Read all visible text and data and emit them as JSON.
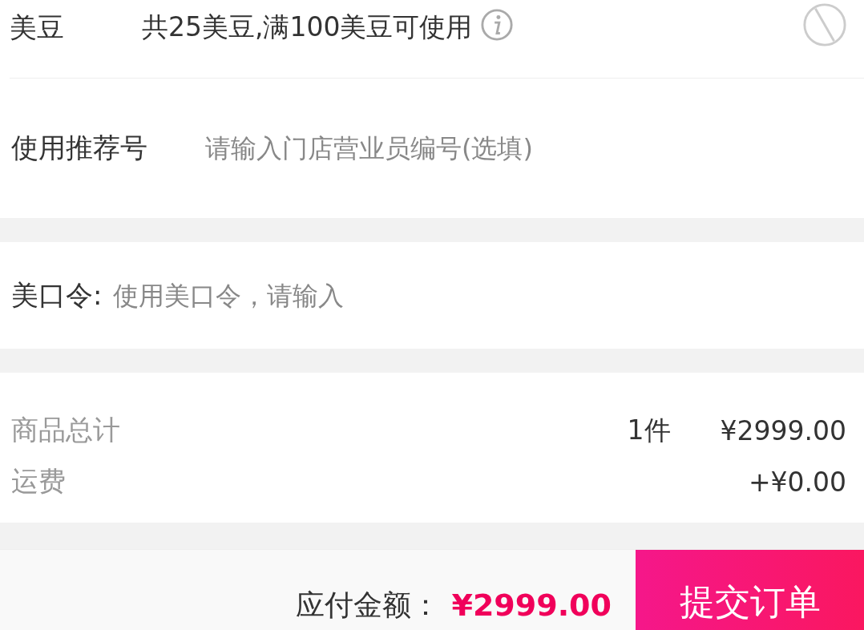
{
  "beans": {
    "label": "美豆",
    "info": "共25美豆,满100美豆可使用"
  },
  "referral": {
    "label": "使用推荐号",
    "placeholder": "请输入门店营业员编号(选填)"
  },
  "coupon_code": {
    "label": "美口令:",
    "placeholder": "使用美口令，请输入"
  },
  "summary": [
    {
      "label": "商品总计",
      "count": "1件",
      "amount": "¥2999.00"
    },
    {
      "label": "运费",
      "amount": "+¥0.00"
    }
  ],
  "footer": {
    "label": "应付金额：",
    "total": "¥2999.00",
    "submit": "提交订单"
  }
}
